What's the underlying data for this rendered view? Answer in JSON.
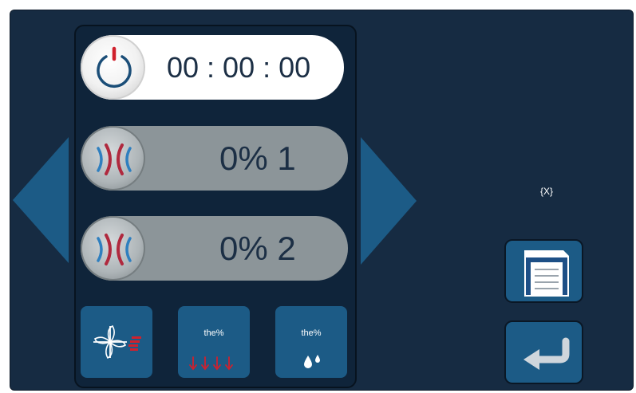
{
  "timer": {
    "value": "00 : 00 : 00",
    "icon": "power-icon"
  },
  "zones": [
    {
      "label": "0% 1",
      "icon": "heat-wave-icon"
    },
    {
      "label": "0% 2",
      "icon": "heat-wave-icon"
    }
  ],
  "tiles": [
    {
      "label": "",
      "icon": "fan-icon"
    },
    {
      "label": "the%",
      "icon": "down-arrows-icon"
    },
    {
      "label": "the%",
      "icon": "water-drops-icon"
    }
  ],
  "placeholder": "{X}",
  "side_buttons": [
    {
      "icon": "save-icon"
    },
    {
      "icon": "return-icon"
    }
  ],
  "nav": {
    "prev_icon": "left-triangle-icon",
    "next_icon": "right-triangle-icon"
  },
  "colors": {
    "background": "#162b42",
    "accent_blue": "#1c5b86",
    "heat_red": "#b0293e",
    "cool_blue": "#2f7fbf",
    "pill_gray": "#8c9599"
  }
}
